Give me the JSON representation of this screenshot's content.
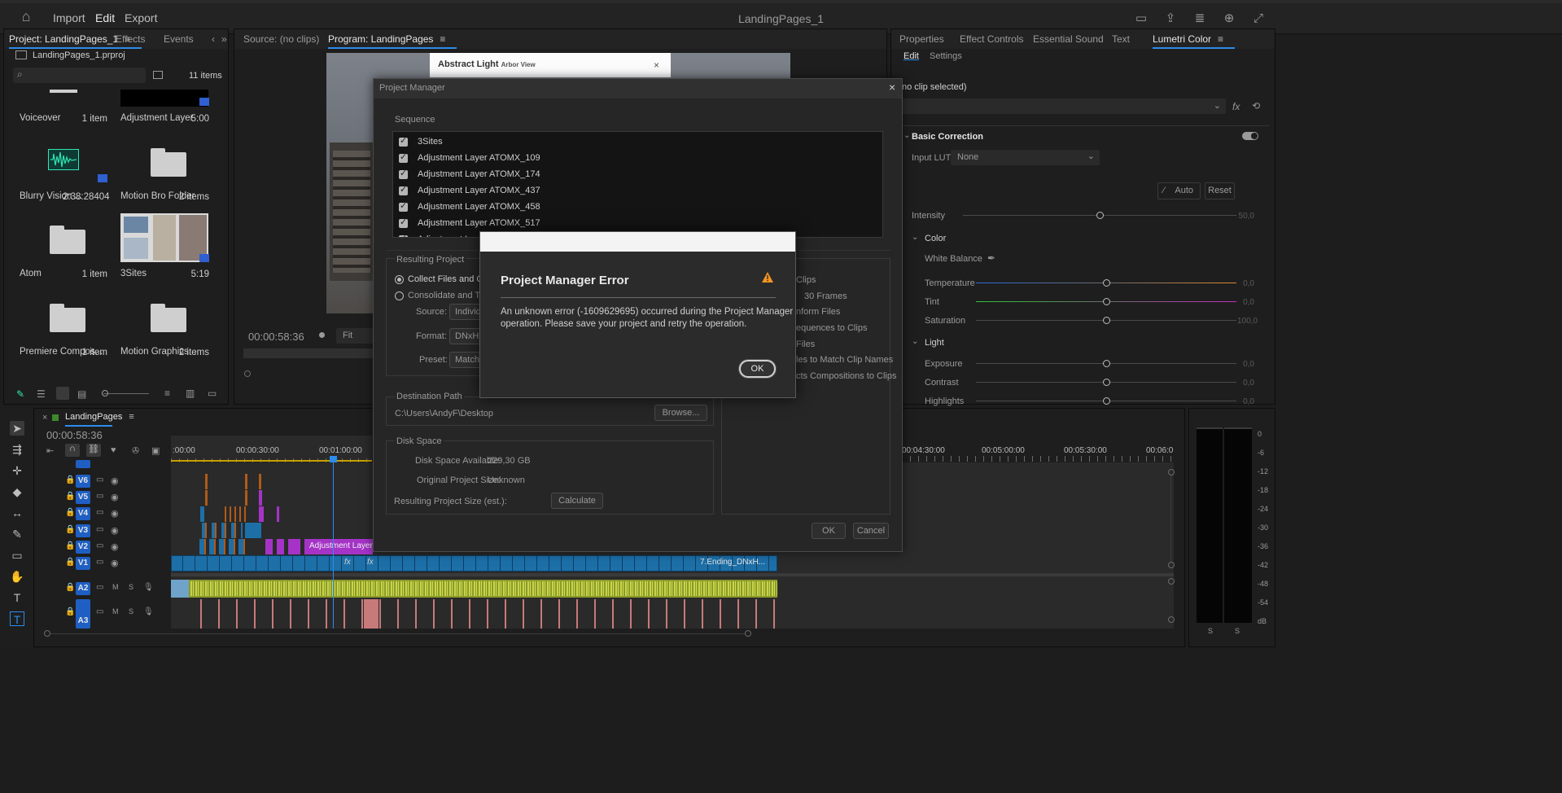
{
  "menubar": {
    "items": [
      "Import",
      "Edit",
      "Export"
    ],
    "active_item": "Edit",
    "app_title": "LandingPages_1"
  },
  "project_panel": {
    "tabs": [
      "Project: LandingPages_1",
      "Effects",
      "Events"
    ],
    "project_file": "LandingPages_1.prproj",
    "items_count": "11 items",
    "items": [
      {
        "name": "Voiceover",
        "meta": "1 item",
        "kind": "folder"
      },
      {
        "name": "Adjustment Layer",
        "meta": "5:00",
        "kind": "adjustment"
      },
      {
        "name": "Blurry Vision ...",
        "meta": "2:38:28404",
        "kind": "audio"
      },
      {
        "name": "Motion Bro Folder",
        "meta": "2 items",
        "kind": "folder"
      },
      {
        "name": "Atom",
        "meta": "1 item",
        "kind": "folder"
      },
      {
        "name": "3Sites",
        "meta": "5:19",
        "kind": "sequence"
      },
      {
        "name": "Premiere Compos...",
        "meta": "1 item",
        "kind": "folder"
      },
      {
        "name": "Motion Graphics...",
        "meta": "2 items",
        "kind": "folder"
      }
    ]
  },
  "source_monitor": {
    "tab": "Source: (no clips)"
  },
  "program_monitor": {
    "tab": "Program: LandingPages",
    "timecode": "00:00:58:36",
    "fit_label": "Fit",
    "preview_card_title": "Abstract Light",
    "preview_card_sub": "Arbor View"
  },
  "right_panel": {
    "tabs": [
      "Properties",
      "Effect Controls",
      "Essential Sound",
      "Text",
      "Lumetri Color"
    ],
    "subtabs": [
      "Edit",
      "Settings"
    ],
    "clip_status": "no clip selected)",
    "basic_correction": "Basic Correction",
    "input_lut_label": "Input LUT",
    "input_lut_value": "None",
    "auto_label": "Auto",
    "reset_label": "Reset",
    "intensity": {
      "label": "Intensity",
      "value": "50,0"
    },
    "color_section": "Color",
    "white_balance": "White Balance",
    "temperature": {
      "label": "Temperature",
      "value": "0,0"
    },
    "tint": {
      "label": "Tint",
      "value": "0,0"
    },
    "saturation": {
      "label": "Saturation",
      "value": "100,0"
    },
    "light_section": "Light",
    "exposure": {
      "label": "Exposure",
      "value": "0,0"
    },
    "contrast": {
      "label": "Contrast",
      "value": "0,0"
    },
    "highlights": {
      "label": "Highlights",
      "value": "0,0"
    }
  },
  "project_manager": {
    "title": "Project Manager",
    "sequence_label": "Sequence",
    "sequences": [
      "3Sites",
      "Adjustment Layer ATOMX_109",
      "Adjustment Layer ATOMX_174",
      "Adjustment Layer ATOMX_437",
      "Adjustment Layer ATOMX_458",
      "Adjustment Layer ATOMX_517",
      "Adjustment Layer"
    ],
    "resulting_project": "Resulting Project",
    "collect_option": "Collect Files and Copy",
    "consolidate_option": "Consolidate and Trans",
    "source_label": "Source:",
    "source_value": "Individu",
    "format_label": "Format:",
    "format_value": "DNxHR",
    "preset_label": "Preset:",
    "preset_value": "Match S",
    "options_right": [
      "Clips",
      "30 Frames",
      "nform Files",
      "equences to Clips",
      "Files",
      "les to Match Clip Names",
      "cts Compositions to Clips"
    ],
    "destination_label": "Destination Path",
    "destination_path": "C:\\Users\\AndyF\\Desktop",
    "browse_label": "Browse...",
    "disk_space_label": "Disk Space",
    "disk_available_label": "Disk Space Available:",
    "disk_available_value": "229,30 GB",
    "original_size_label": "Original Project Size:",
    "original_size_value": "Unknown",
    "resulting_size_label": "Resulting Project Size (est.):",
    "calculate_label": "Calculate",
    "ok_label": "OK",
    "cancel_label": "Cancel"
  },
  "error_dialog": {
    "title": "Project Manager Error",
    "message_line1": "An unknown error (-1609629695) occurred during the Project Manager",
    "message_line2": "operation. Please save your project and retry the operation.",
    "ok_label": "OK"
  },
  "timeline": {
    "tab": "LandingPages",
    "timecode": "00:00:58:36",
    "ruler_left": [
      ":00:00",
      "00:00:30:00",
      "00:01:00:00"
    ],
    "ruler_right": [
      "00:04:30:00",
      "00:05:00:00",
      "00:05:30:00",
      "00:06:0"
    ],
    "video_tracks": [
      "V6",
      "V5",
      "V4",
      "V3",
      "V2",
      "V1"
    ],
    "audio_tracks": [
      "A2",
      "A3"
    ],
    "adjustment_clip": "Adjustment Layer",
    "ending_clip": "7.Ending_DNxH...",
    "fx_label": "fx",
    "mute_label": "M",
    "solo_label": "S"
  },
  "audio_meter": {
    "scale": [
      "0",
      "-6",
      "-12",
      "-18",
      "-24",
      "-30",
      "-36",
      "-42",
      "-48",
      "-54",
      "dB"
    ],
    "channel_labels": [
      "S",
      "S"
    ]
  },
  "colors": {
    "accent_blue": "#2d8ceb",
    "warning_orange": "#f29423",
    "video_clip": "#1d6fa8",
    "adjustment_clip": "#a533c7",
    "audio_clip": "#c9d24a"
  }
}
